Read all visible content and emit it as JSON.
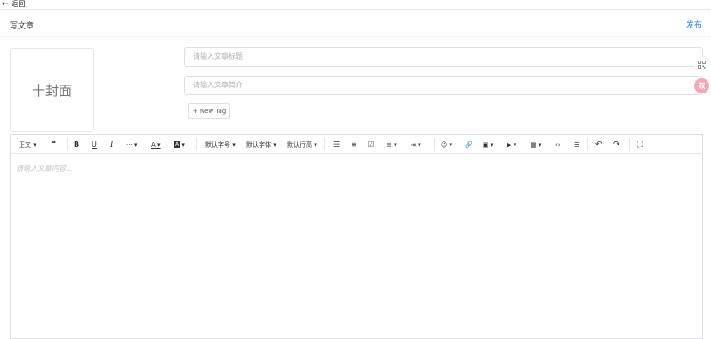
{
  "nav": {
    "back_label": "返回",
    "back_icon": "arrow-left-icon"
  },
  "header": {
    "title": "写文章",
    "publish_label": "发布"
  },
  "cover": {
    "label": "十封面"
  },
  "form": {
    "title_placeholder": "请输入文章标题",
    "intro_placeholder": "请输入文章简介",
    "tag_button": "+ New Tag"
  },
  "side": {
    "avatar_text": "双"
  },
  "toolbar": {
    "paragraph": "正文",
    "font_size": "默认字号",
    "font_family": "默认字体",
    "line_height": "默认行高"
  },
  "editor": {
    "placeholder": "请输入文章内容..."
  },
  "colors": {
    "accent": "#2f80ed",
    "border": "#dcdfe6",
    "avatar_bg": "#f4a7b5"
  }
}
